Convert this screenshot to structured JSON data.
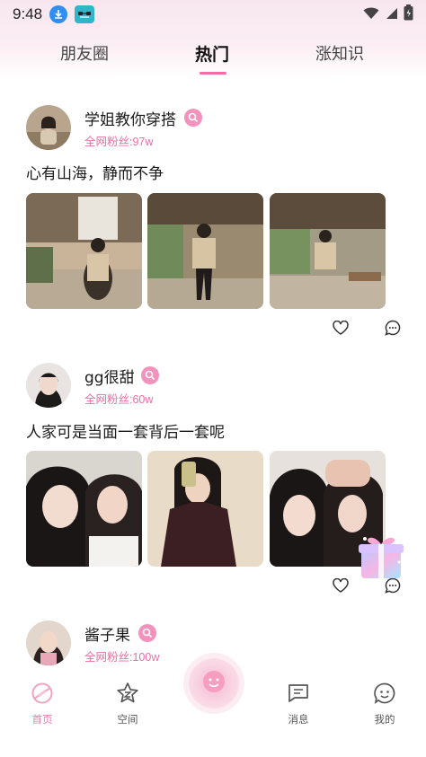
{
  "status_bar": {
    "time": "9:48"
  },
  "tabs": [
    {
      "label": "朋友圈"
    },
    {
      "label": "热门"
    },
    {
      "label": "涨知识"
    }
  ],
  "active_tab": "热门",
  "posts": [
    {
      "username": "学姐教你穿搭",
      "fans": "全网粉丝:97w",
      "caption": "心有山海，静而不争"
    },
    {
      "username": "gg很甜",
      "fans": "全网粉丝:60w",
      "caption": "人家可是当面一套背后一套呢"
    },
    {
      "username": "酱子果",
      "fans": "全网粉丝:100w"
    }
  ],
  "bottom_nav": {
    "home": "首页",
    "space": "空间",
    "messages": "消息",
    "mine": "我的"
  },
  "colors": {
    "accent": "#f07ca9",
    "fans_text": "#ec6ea4",
    "badge": "#f392bd"
  }
}
